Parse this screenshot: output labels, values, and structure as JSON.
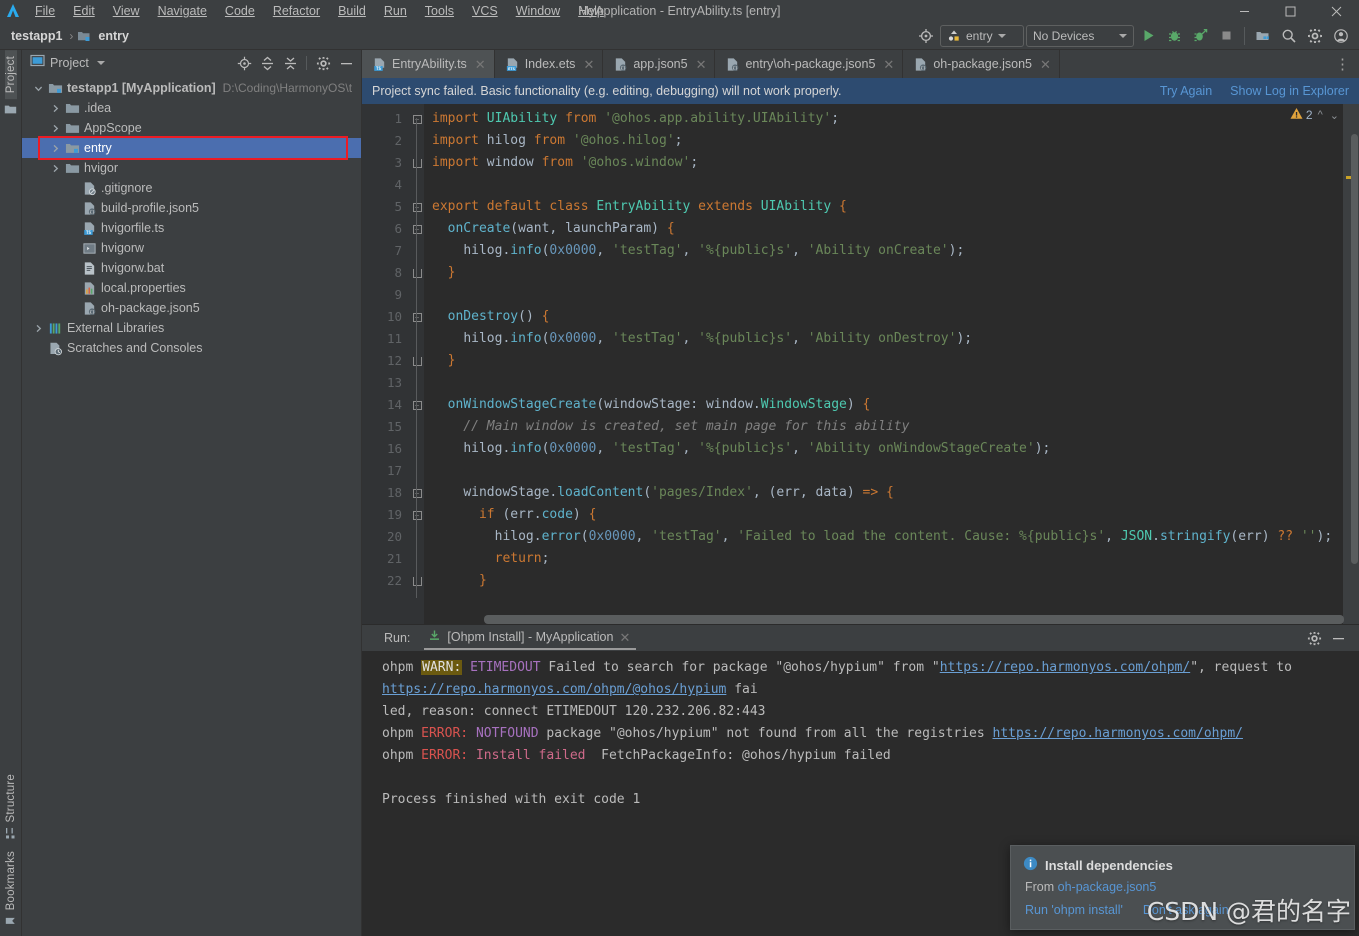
{
  "window": {
    "title": "MyApplication - EntryAbility.ts [entry]",
    "controls": {
      "minimize": "minimize-icon",
      "maximize": "maximize-icon",
      "close": "close-icon"
    }
  },
  "menu": {
    "items": [
      "File",
      "Edit",
      "View",
      "Navigate",
      "Code",
      "Refactor",
      "Build",
      "Run",
      "Tools",
      "VCS",
      "Window",
      "Help"
    ]
  },
  "navbar": {
    "crumbs": [
      "testapp1",
      "entry"
    ],
    "separator": "›",
    "run_config": "entry",
    "device": "No Devices",
    "icons": [
      "target-icon",
      "run-icon",
      "debug-icon",
      "profile-icon",
      "stop-icon",
      "device-manager-icon",
      "search-icon",
      "gear-icon",
      "account-icon"
    ]
  },
  "project_panel": {
    "title": "Project",
    "header_icons": [
      "locate-icon",
      "expand-all-icon",
      "collapse-all-icon",
      "gear-icon",
      "hide-icon"
    ],
    "tree": [
      {
        "label": "testapp1 [MyApplication]",
        "path": "D:\\Coding\\HarmonyOS\\t",
        "icon": "module-folder-icon",
        "arrow": "expanded",
        "indent": 0,
        "bold_part": "[MyApplication]",
        "selected": false
      },
      {
        "label": ".idea",
        "path": "",
        "icon": "folder-icon",
        "arrow": "collapsed",
        "indent": 1,
        "selected": false
      },
      {
        "label": "AppScope",
        "path": "",
        "icon": "folder-icon",
        "arrow": "collapsed",
        "indent": 1,
        "selected": false
      },
      {
        "label": "entry",
        "path": "",
        "icon": "module-folder-icon",
        "arrow": "collapsed",
        "indent": 1,
        "selected": true
      },
      {
        "label": "hvigor",
        "path": "",
        "icon": "folder-icon",
        "arrow": "collapsed",
        "indent": 1,
        "selected": false
      },
      {
        "label": ".gitignore",
        "path": "",
        "icon": "gitignore-icon",
        "arrow": "none",
        "indent": 2,
        "selected": false
      },
      {
        "label": "build-profile.json5",
        "path": "",
        "icon": "json5-icon",
        "arrow": "none",
        "indent": 2,
        "selected": false
      },
      {
        "label": "hvigorfile.ts",
        "path": "",
        "icon": "ts-icon",
        "arrow": "none",
        "indent": 2,
        "selected": false
      },
      {
        "label": "hvigorw",
        "path": "",
        "icon": "script-icon",
        "arrow": "none",
        "indent": 2,
        "selected": false
      },
      {
        "label": "hvigorw.bat",
        "path": "",
        "icon": "bat-icon",
        "arrow": "none",
        "indent": 2,
        "selected": false
      },
      {
        "label": "local.properties",
        "path": "",
        "icon": "properties-icon",
        "arrow": "none",
        "indent": 2,
        "selected": false
      },
      {
        "label": "oh-package.json5",
        "path": "",
        "icon": "json5-icon",
        "arrow": "none",
        "indent": 2,
        "selected": false
      },
      {
        "label": "External Libraries",
        "path": "",
        "icon": "libraries-icon",
        "arrow": "collapsed",
        "indent": 0,
        "selected": false
      },
      {
        "label": "Scratches and Consoles",
        "path": "",
        "icon": "scratches-icon",
        "arrow": "none",
        "indent": 0,
        "selected": false
      }
    ],
    "highlight_row_index": 3,
    "highlight_color": "#ec1c24"
  },
  "tool_strip": {
    "left_top": [
      "Project"
    ],
    "left_bottom": [
      "Structure",
      "Bookmarks"
    ]
  },
  "editor": {
    "tabs": [
      {
        "label": "EntryAbility.ts",
        "icon": "ts-file-icon",
        "active": true
      },
      {
        "label": "Index.ets",
        "icon": "ets-file-icon",
        "active": false
      },
      {
        "label": "app.json5",
        "icon": "json5-file-icon",
        "active": false
      },
      {
        "label": "entry\\oh-package.json5",
        "icon": "json5-file-icon",
        "active": false
      },
      {
        "label": "oh-package.json5",
        "icon": "json5-file-icon",
        "active": false
      }
    ],
    "overflow_icon": "more-options-icon",
    "notification": {
      "message": "Project sync failed. Basic functionality (e.g. editing, debugging) will not work properly.",
      "links": [
        "Try Again",
        "Show Log in Explorer"
      ],
      "background": "#2d4b70"
    },
    "warning_count": "2",
    "warning_icon": "warning-triangle-icon",
    "nav_up_icon": "chevron-up-icon",
    "nav_down_icon": "chevron-down-icon",
    "line_numbers": [
      1,
      2,
      3,
      4,
      5,
      6,
      7,
      8,
      9,
      10,
      11,
      12,
      13,
      14,
      15,
      16,
      17,
      18,
      19,
      20,
      21,
      22
    ],
    "code_lines": [
      "import UIAbility from '@ohos.app.ability.UIAbility';",
      "import hilog from '@ohos.hilog';",
      "import window from '@ohos.window';",
      "",
      "export default class EntryAbility extends UIAbility {",
      "  onCreate(want, launchParam) {",
      "    hilog.info(0x0000, 'testTag', '%{public}s', 'Ability onCreate');",
      "  }",
      "",
      "  onDestroy() {",
      "    hilog.info(0x0000, 'testTag', '%{public}s', 'Ability onDestroy');",
      "  }",
      "",
      "  onWindowStageCreate(windowStage: window.WindowStage) {",
      "    // Main window is created, set main page for this ability",
      "    hilog.info(0x0000, 'testTag', '%{public}s', 'Ability onWindowStageCreate');",
      "",
      "    windowStage.loadContent('pages/Index', (err, data) => {",
      "      if (err.code) {",
      "        hilog.error(0x0000, 'testTag', 'Failed to load the content. Cause: %{public}s', JSON.stringify(err) ?? '');",
      "        return;",
      "      }"
    ]
  },
  "run_panel": {
    "label": "Run:",
    "tab": "[Ohpm Install] - MyApplication",
    "tab_icon": "install-icon",
    "close_icon": "close-icon",
    "header_icons": [
      "gear-icon",
      "hide-icon"
    ],
    "console_lines": [
      {
        "segments": [
          {
            "text": "ohpm ",
            "style": "plain"
          },
          {
            "text": "WARN:",
            "style": "warn"
          },
          {
            "text": " ",
            "style": "plain"
          },
          {
            "text": "ETIMEDOUT",
            "style": "magenta"
          },
          {
            "text": " Failed to search for package \"@ohos/hypium\" from \"",
            "style": "plain"
          },
          {
            "text": "https://repo.harmonyos.com/ohpm/",
            "style": "link"
          },
          {
            "text": "\", request to ",
            "style": "plain"
          },
          {
            "text": "https://repo.harmonyos.com/ohpm/@ohos/hypium",
            "style": "link"
          },
          {
            "text": " fai",
            "style": "plain"
          }
        ]
      },
      {
        "segments": [
          {
            "text": "led, reason: connect ETIMEDOUT 120.232.206.82:443",
            "style": "plain"
          }
        ]
      },
      {
        "segments": [
          {
            "text": "ohpm ",
            "style": "plain"
          },
          {
            "text": "ERROR:",
            "style": "red"
          },
          {
            "text": " ",
            "style": "plain"
          },
          {
            "text": "NOTFOUND",
            "style": "magenta"
          },
          {
            "text": " package \"@ohos/hypium\" not found from all the registries ",
            "style": "plain"
          },
          {
            "text": "https://repo.harmonyos.com/ohpm/",
            "style": "link"
          }
        ]
      },
      {
        "segments": [
          {
            "text": "ohpm ",
            "style": "plain"
          },
          {
            "text": "ERROR:",
            "style": "red"
          },
          {
            "text": " ",
            "style": "plain"
          },
          {
            "text": "Install failed",
            "style": "pink"
          },
          {
            "text": "  FetchPackageInfo: @ohos/hypium failed",
            "style": "plain"
          }
        ]
      },
      {
        "segments": []
      },
      {
        "segments": [
          {
            "text": "Process finished with exit code 1",
            "style": "plain"
          }
        ]
      }
    ]
  },
  "popup": {
    "icon": "info-icon",
    "title": "Install dependencies",
    "from_label": "From",
    "from_link": "oh-package.json5",
    "actions": [
      "Run 'ohpm install'",
      "Don't ask again"
    ]
  },
  "watermark": "CSDN @君的名字"
}
